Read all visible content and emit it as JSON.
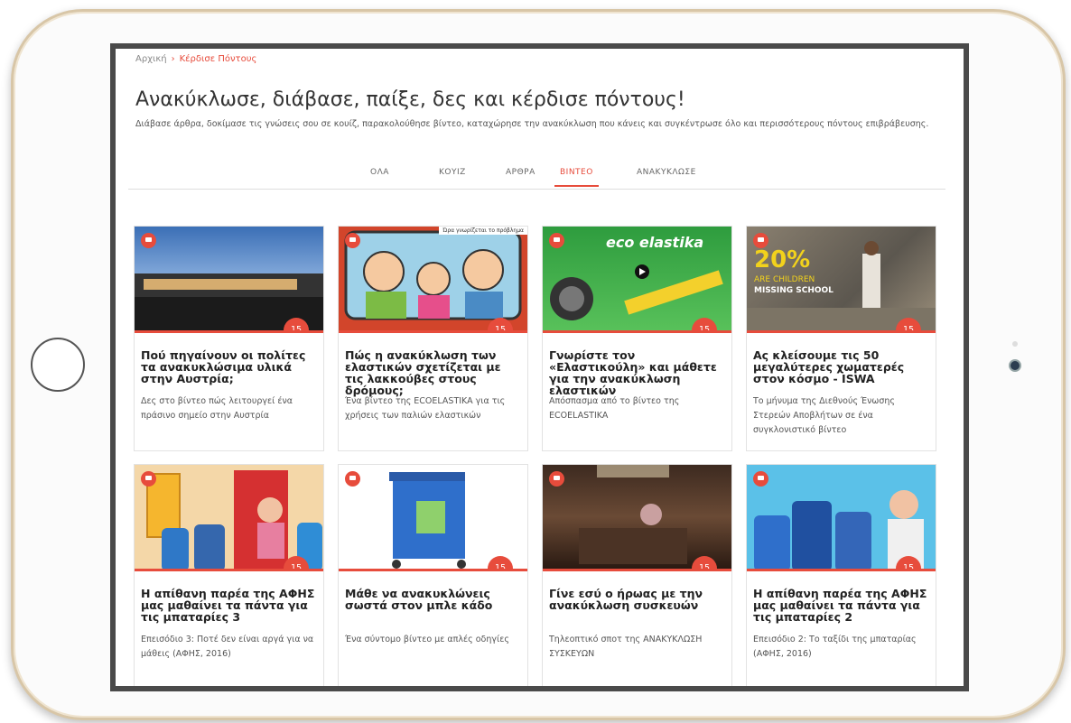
{
  "breadcrumb": {
    "home": "Αρχική",
    "separator": "›",
    "current": "Κέρδισε Πόντους"
  },
  "page": {
    "title": "Ανακύκλωσε, διάβασε, παίξε, δες και κέρδισε πόντους!",
    "subtitle": "Διάβασε άρθρα, δοκίμασε τις γνώσεις σου σε κουίζ, παρακολούθησε βίντεο, καταχώρησε την ανακύκλωση που κάνεις και συγκέντρωσε όλο και περισσότερους πόντους επιβράβευσης."
  },
  "tabs": [
    {
      "label": "ΟΛΑ"
    },
    {
      "label": "ΚΟΥΙΖ"
    },
    {
      "label": "ΑΡΘΡΑ"
    },
    {
      "label": "ΒΙΝΤΕΟ",
      "active": true
    },
    {
      "label": "ΑΝΑΚΥΚΛΩΣΕ"
    }
  ],
  "cards": [
    {
      "title": "Πού πηγαίνουν οι πολίτες τα ανακυκλώσιμα υλικά στην Αυστρία;",
      "desc": "Δες στο βίντεο πώς λειτουργεί ένα πράσινο σημείο στην Αυστρία",
      "points": "15",
      "icon": "video-icon"
    },
    {
      "title": "Πώς η ανακύκλωση των ελαστικών σχετίζεται με τις λακκούβες στους δρόμους;",
      "desc": "Ένα βίντεο της ECOELASTIKA για τις χρήσεις των παλιών ελαστικών",
      "points": "15",
      "icon": "video-icon",
      "thumb_text": "Ώρα γνωρίζεται το πρόβλημα"
    },
    {
      "title": "Γνωρίστε τον «Ελαστικούλη» και μάθετε για την ανακύκλωση ελαστικών",
      "desc": "Απόσπασμα από το βίντεο της ECOELASTIKA",
      "points": "15",
      "icon": "video-icon",
      "thumb_text": "eco elastika"
    },
    {
      "title": "Ας κλείσουμε τις 50 μεγαλύτερες χωματερές στον κόσμο - ISWA",
      "desc": "Το μήνυμα της Διεθνούς Ένωσης Στερεών Αποβλήτων σε ένα συγκλονιστικό βίντεο",
      "points": "15",
      "icon": "video-icon",
      "thumb_text": "20%",
      "thumb_text2": "ARE CHILDREN",
      "thumb_text3": "MISSING SCHOOL"
    },
    {
      "title": "Η απίθανη παρέα της ΑΦΗΣ μας μαθαίνει τα πάντα για τις μπαταρίες 3",
      "desc": "Επεισόδιο 3: Ποτέ δεν είναι αργά για να μάθεις (ΑΦΗΣ, 2016)",
      "points": "15",
      "icon": "video-icon"
    },
    {
      "title": "Μάθε να ανακυκλώνεις σωστά στον μπλε κάδο",
      "desc": "Ένα σύντομο βίντεο με απλές οδηγίες",
      "points": "15",
      "icon": "video-icon"
    },
    {
      "title": "Γίνε εσύ ο ήρωας με την ανακύκλωση συσκευών",
      "desc": "Τηλεοπτικό σποτ της ΑΝΑΚΥΚΛΩΣΗ ΣΥΣΚΕΥΩΝ",
      "points": "15",
      "icon": "video-icon"
    },
    {
      "title": "Η απίθανη παρέα της ΑΦΗΣ μας μαθαίνει τα πάντα για τις μπαταρίες 2",
      "desc": "Επεισόδιο 2: Το ταξίδι της μπαταρίας (ΑΦΗΣ, 2016)",
      "points": "15",
      "icon": "video-icon"
    }
  ],
  "colors": {
    "accent": "#e74c3c",
    "frame": "#4a4a4a"
  }
}
